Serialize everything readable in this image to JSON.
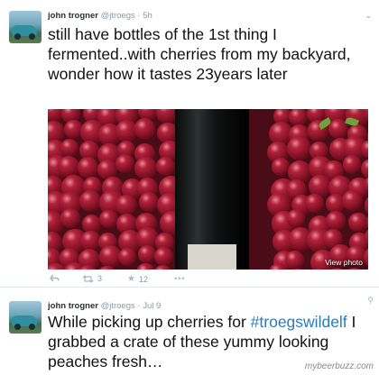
{
  "tweets": [
    {
      "name": "john trogner",
      "handle": "@jtroegs",
      "time": "5h",
      "text": "still have bottles of the 1st thing I fermented..with cherries from my backyard, wonder how it tastes 23years later",
      "photo_link": "View photo",
      "retweets": "3",
      "favorites": "12",
      "icons": [
        "reply-icon",
        "retweet-icon",
        "favorite-icon",
        "more-icon"
      ]
    },
    {
      "name": "john trogner",
      "handle": "@jtroegs",
      "time": "Jul 9",
      "text_before_hashtag": "While picking up cherries for ",
      "hashtag": "#troegswildelf",
      "text_after_hashtag": " I grabbed a crate of these yummy looking peaches fresh…",
      "icons": [
        "location-pin-icon"
      ]
    }
  ],
  "watermark": "mybeerbuzz.com",
  "colors": {
    "link": "#2b7bb9",
    "muted": "#8899a6",
    "divider": "#e1e8ed"
  }
}
